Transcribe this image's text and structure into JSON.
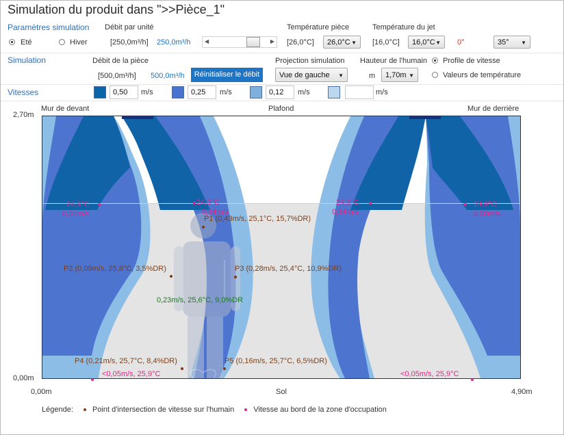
{
  "window": {
    "title": "Simulation du produit dans \">>Pièce_1\""
  },
  "params": {
    "section_label": "Paramètres simulation",
    "debit_label": "Débit par unité",
    "season_ete": "Eté",
    "season_hiver": "Hiver",
    "season_selected": "Eté",
    "debit_range": "[250,0m³/h]",
    "debit_value": "250,0m³/h",
    "debit_slider_fraction": 0.83,
    "room_temp_label": "Température pièce",
    "room_temp_range": "[26,0°C]",
    "room_temp_value": "26,0°C",
    "jet_temp_label": "Température du jet",
    "jet_temp_range": "[16,0°C]",
    "jet_temp_value": "16,0°C",
    "angle_red": "0°",
    "angle_value": "35°"
  },
  "simulation": {
    "section_label": "Simulation",
    "debit_piece_label": "Débit de la pièce",
    "debit_piece_range": "[500,0m³/h]",
    "debit_piece_value": "500,0m³/h",
    "reset_button": "Réinitialiser le débit",
    "projection_label": "Projection simulation",
    "projection_value": "Vue de gauche",
    "hauteur_label": "Hauteur de l'humain",
    "hauteur_unit": "m",
    "hauteur_value": "1,70m",
    "radio_profil": "Profile de vitesse",
    "radio_valeurs": "Valeurs de température",
    "radio_selected": "Profile de vitesse"
  },
  "vitesses": {
    "section_label": "Vitesses",
    "unit": "m/s",
    "items": [
      {
        "color": "#0a66a8",
        "value": "0,50"
      },
      {
        "color": "#4a72cf",
        "value": "0,25"
      },
      {
        "color": "#7fb0dd",
        "value": "0,12"
      },
      {
        "color": "#bcd8f1",
        "value": ""
      }
    ]
  },
  "chart": {
    "y_top": "2,70m",
    "y_bottom": "0,00m",
    "x_left": "0,00m",
    "x_right": "4,90m",
    "x_center": "Sol",
    "wall_front": "Mur de devant",
    "ceiling": "Plafond",
    "wall_back": "Mur de derrière",
    "labels": {
      "p1": "P1 (0,43m/s, 25,1°C, 15,7%DR)",
      "p2": "P2 (0,09m/s, 25,8°C, 3,5%DR)",
      "p3": "P3 (0,28m/s, 25,4°C, 10,9%DR)",
      "center": "0,23m/s, 25,6°C, 9,0%DR",
      "p4": "P4 (0,21m/s, 25,7°C, 8,4%DR)",
      "p5": "P5 (0,16m/s, 25,7°C, 6,5%DR)",
      "edge_temp": "24,9°C",
      "edge_vel_left": "0,50m/s",
      "edge_vel_midleft": "0,54m/s",
      "edge_vel_midright": "0,54m/s",
      "edge_vel_right": "0,50m/s",
      "floor": "<0,05m/s, 25,9°C"
    }
  },
  "legend": {
    "title": "Légende:",
    "item1": "Point d'intersection de vitesse sur l'humain",
    "item2": "Vitesse au bord de la zone d'occupation",
    "color1": "#8b3a12",
    "color2": "#e02586"
  }
}
